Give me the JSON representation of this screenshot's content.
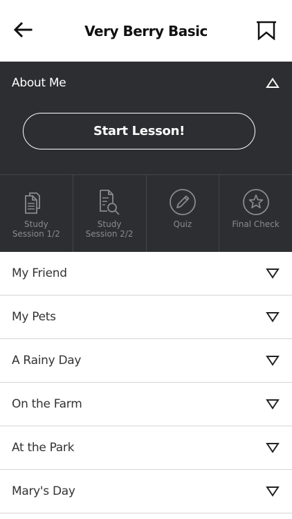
{
  "header": {
    "title": "Very Berry Basic",
    "back_icon": "back-arrow-icon",
    "bookmark_icon": "bookmark-icon"
  },
  "about": {
    "label": "About Me",
    "expanded": true,
    "start_button": "Start Lesson!",
    "activities": [
      {
        "label": "Study\nSession 1/2",
        "icon": "documents-icon"
      },
      {
        "label": "Study\nSession 2/2",
        "icon": "document-search-icon"
      },
      {
        "label": "Quiz",
        "icon": "pencil-icon"
      },
      {
        "label": "Final Check",
        "icon": "star-icon"
      }
    ]
  },
  "lessons": [
    {
      "label": "My Friend"
    },
    {
      "label": "My Pets"
    },
    {
      "label": "A Rainy Day"
    },
    {
      "label": "On the Farm"
    },
    {
      "label": "At the Park"
    },
    {
      "label": "Mary's Day"
    }
  ],
  "colors": {
    "panel_bg": "#2d2e31",
    "activity_text": "#8a8b8f",
    "divider": "#d5d5d5"
  }
}
